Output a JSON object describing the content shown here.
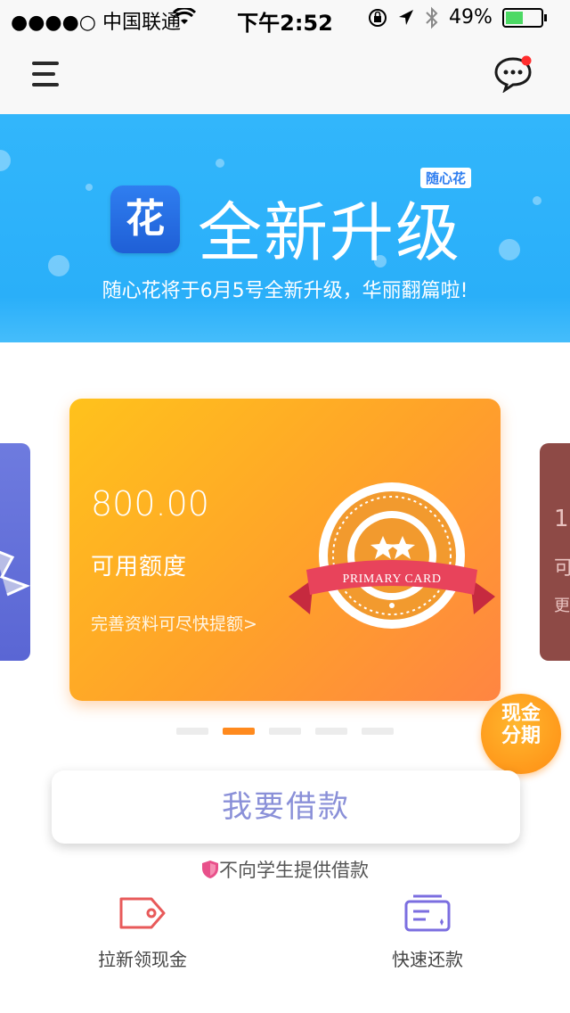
{
  "status_bar": {
    "carrier": "●●●●○ 中国联通",
    "time": "下午2:52",
    "battery": "49%"
  },
  "nav": {
    "menu_icon": "menu-icon",
    "messages_icon": "message-bubble-icon",
    "unread_dot_color": "#ff2d2d"
  },
  "banner": {
    "app_icon_char": "花",
    "tag": "随心花",
    "headline": "全新升级",
    "subtitle": "随心花将于6月5号全新升级，华丽翻篇啦!"
  },
  "card": {
    "amount": "800.00",
    "credit_label": "可用额度",
    "improve_link": "完善资料可尽快提额>",
    "badge_text": "PRIMARY CARD",
    "badge_stars": 2,
    "right_card_partial": [
      "1",
      "可",
      "更"
    ]
  },
  "carousel": {
    "count": 5,
    "active_index": 1
  },
  "cash_badge": {
    "line1": "现金",
    "line2": "分期"
  },
  "borrow_button": {
    "label": "我要借款"
  },
  "notice": {
    "text": "不向学生提供借款"
  },
  "bottom_actions": [
    {
      "label": "拉新领现金",
      "icon": "tag-icon"
    },
    {
      "label": "快速还款",
      "icon": "repay-card-icon"
    }
  ],
  "colors": {
    "accent": "#ff8a1e",
    "banner": "#2aaff9",
    "borrow_text": "#8a90d8"
  }
}
